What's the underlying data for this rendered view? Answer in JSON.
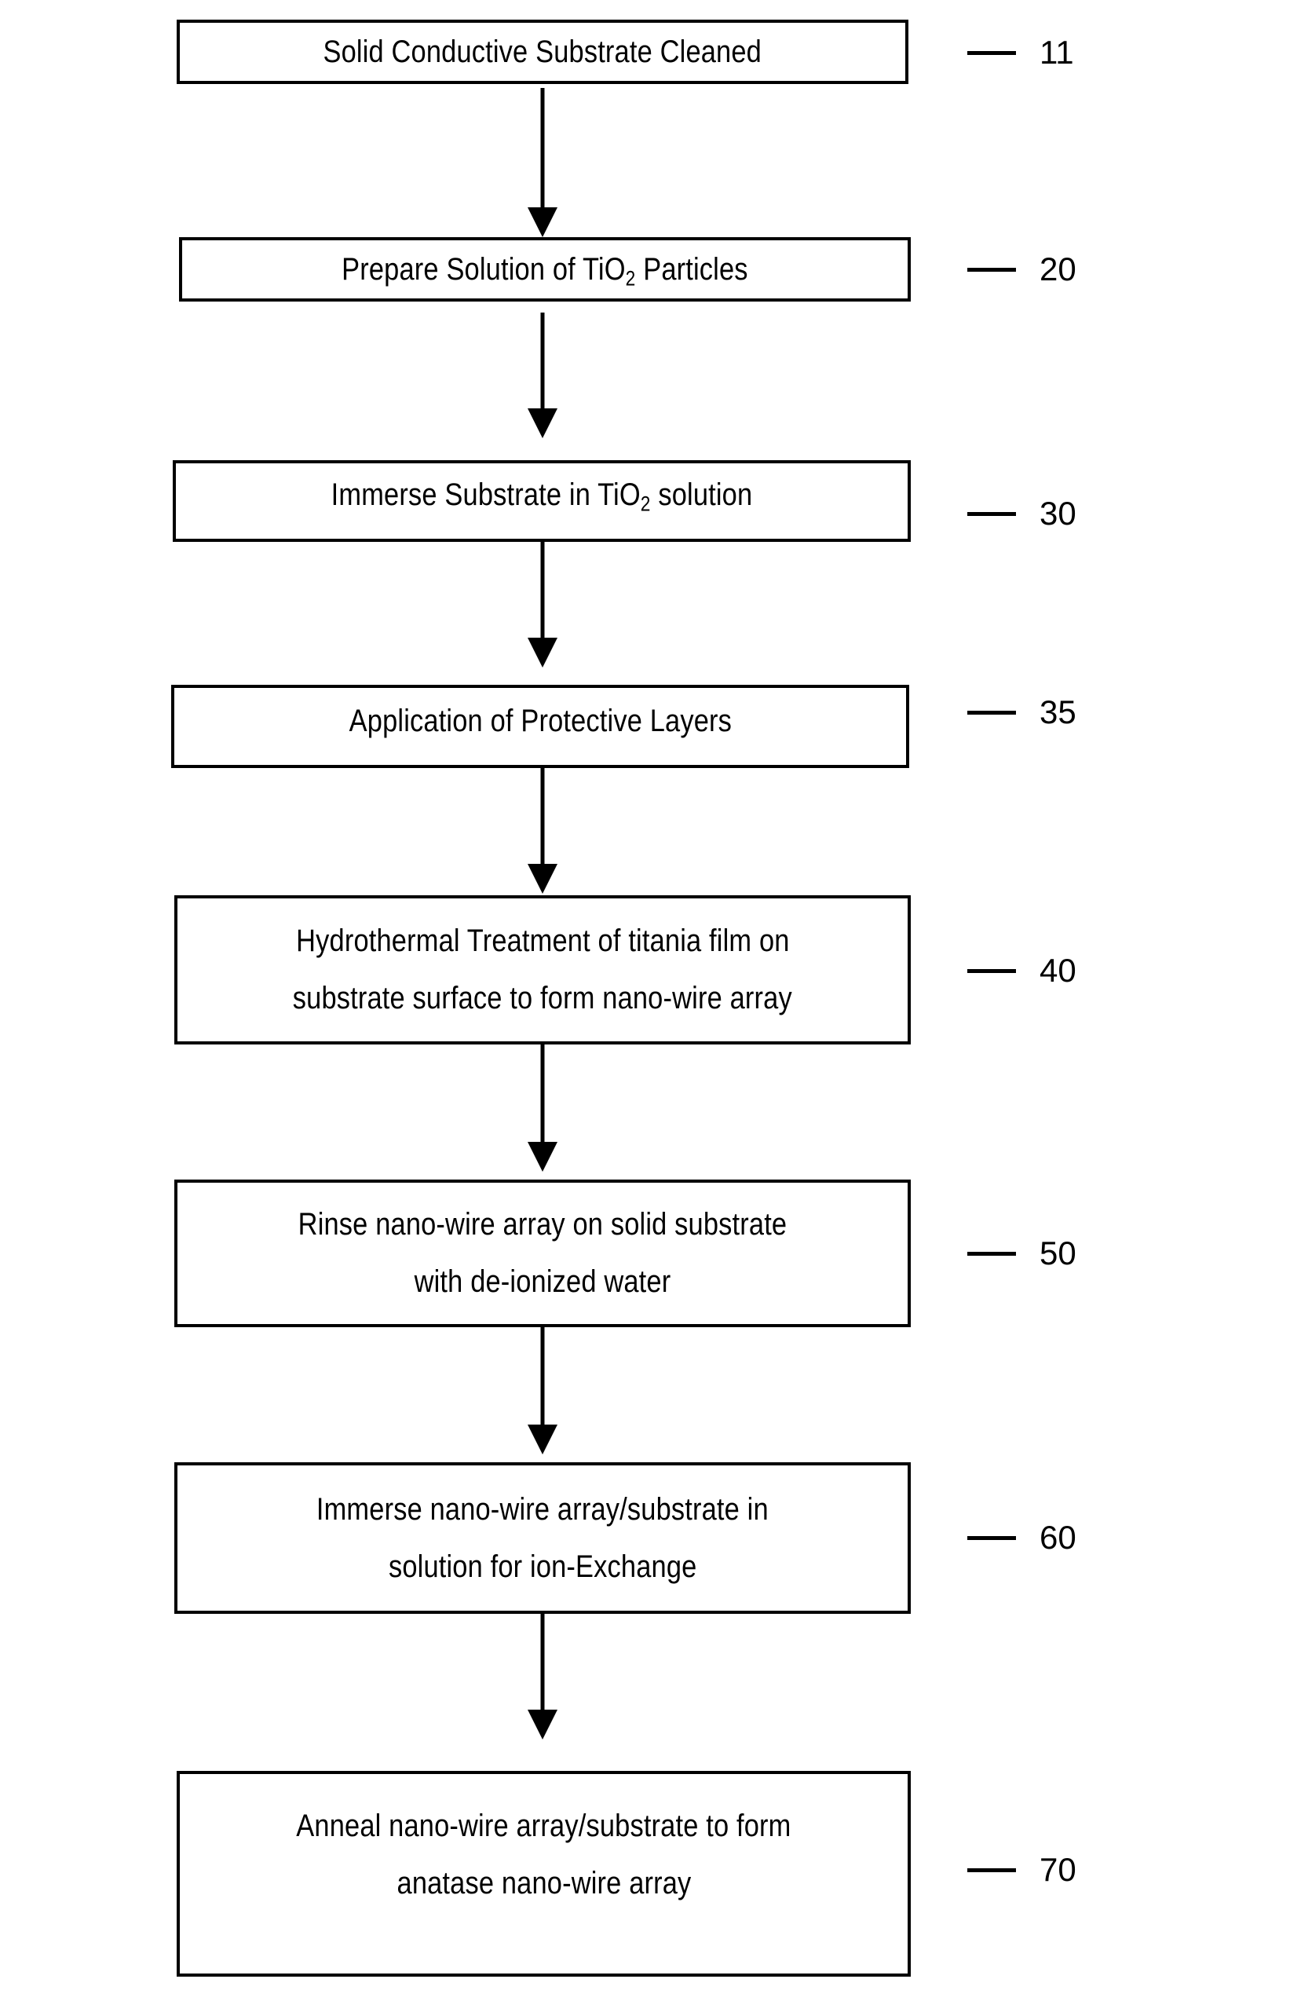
{
  "diagram": {
    "type": "flowchart",
    "orientation": "vertical",
    "colors": {
      "background": "#ffffff",
      "stroke": "#000000",
      "text": "#000000"
    },
    "steps": [
      {
        "id": "step-1",
        "lines": [
          "Solid Conductive Substrate Cleaned"
        ],
        "ref": "11"
      },
      {
        "id": "step-2",
        "lines": [
          "Prepare Solution of TiO",
          "2",
          " Particles"
        ],
        "text_pre": "Prepare Solution of TiO",
        "text_sub": "2",
        "text_post": " Particles",
        "ref": "20"
      },
      {
        "id": "step-3",
        "lines": [
          "Immerse Substrate in TiO",
          "2",
          " solution"
        ],
        "text_pre": "Immerse Substrate in TiO",
        "text_sub": "2",
        "text_post": " solution",
        "ref": "30"
      },
      {
        "id": "step-4",
        "lines": [
          "Application of Protective Layers"
        ],
        "ref": "35"
      },
      {
        "id": "step-5",
        "lines": [
          "Hydrothermal Treatment of titania film on",
          "substrate surface to form nano-wire array"
        ],
        "ref": "40"
      },
      {
        "id": "step-6",
        "lines": [
          "Rinse nano-wire array on solid substrate",
          "with de-ionized water"
        ],
        "ref": "50"
      },
      {
        "id": "step-7",
        "lines": [
          "Immerse nano-wire array/substrate in",
          "solution for ion-Exchange"
        ],
        "ref": "60"
      },
      {
        "id": "step-8",
        "lines": [
          "Anneal nano-wire array/substrate to form",
          "anatase nano-wire array"
        ],
        "ref": "70"
      }
    ],
    "connectors": [
      {
        "id": "arrow-1-2",
        "from": "step-1",
        "to": "step-2"
      },
      {
        "id": "arrow-2-3",
        "from": "step-2",
        "to": "step-3"
      },
      {
        "id": "arrow-3-4",
        "from": "step-3",
        "to": "step-4"
      },
      {
        "id": "arrow-4-5",
        "from": "step-4",
        "to": "step-5"
      },
      {
        "id": "arrow-5-6",
        "from": "step-5",
        "to": "step-6"
      },
      {
        "id": "arrow-6-7",
        "from": "step-6",
        "to": "step-7"
      },
      {
        "id": "arrow-7-8",
        "from": "step-7",
        "to": "step-8"
      }
    ]
  }
}
